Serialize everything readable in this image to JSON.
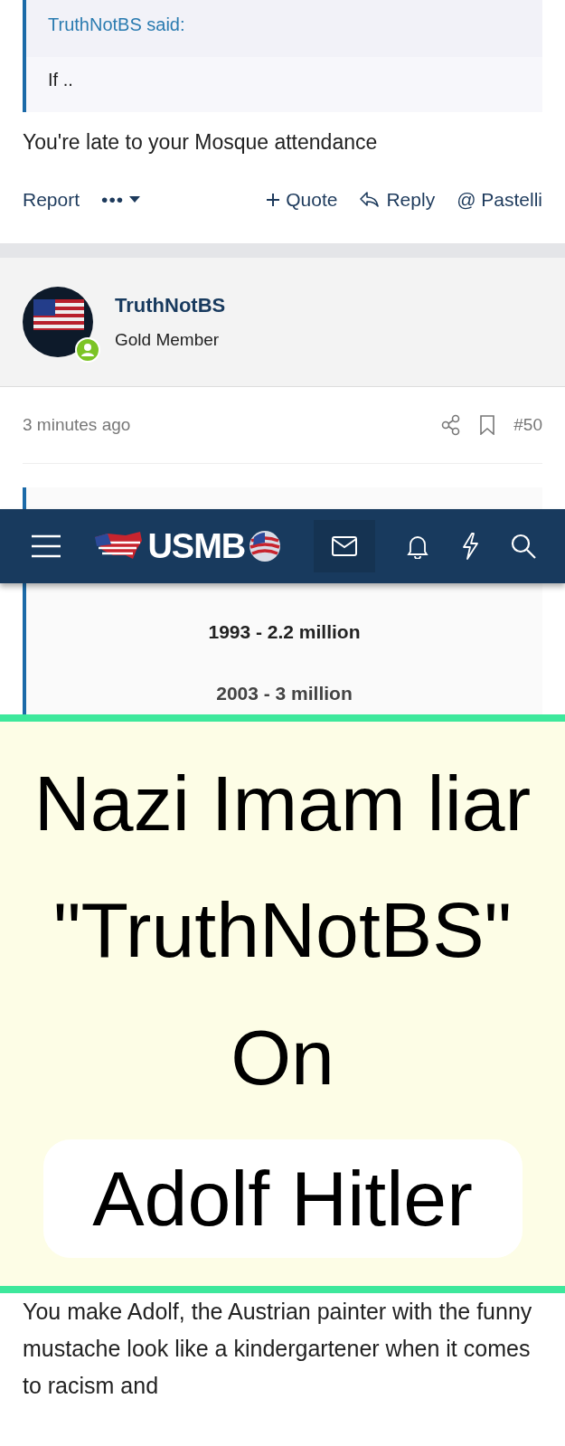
{
  "prev_post": {
    "quote": {
      "author": "TruthNotBS said:",
      "text": "If .."
    },
    "body": "You're late to your Mosque attendance",
    "actions": {
      "report": "Report",
      "more": "•••",
      "quote": "Quote",
      "reply": "Reply",
      "mention": "@ Pastelli"
    }
  },
  "post": {
    "author": "TruthNotBS",
    "role": "Gold Member",
    "online": true,
    "time": "3 minutes ago",
    "number": "#50",
    "quote_lines": [
      "1993 - 2.2 million",
      "2003 - 3 million"
    ]
  },
  "nav": {
    "logo": "USMB"
  },
  "overlay": {
    "lines": [
      "Nazi Imam liar",
      "\"TruthNotBS\"",
      "On",
      "Adolf Hitler"
    ]
  },
  "reply_text": "You make Adolf, the Austrian painter with the funny mustache look like a kindergartener when it comes to racism and"
}
